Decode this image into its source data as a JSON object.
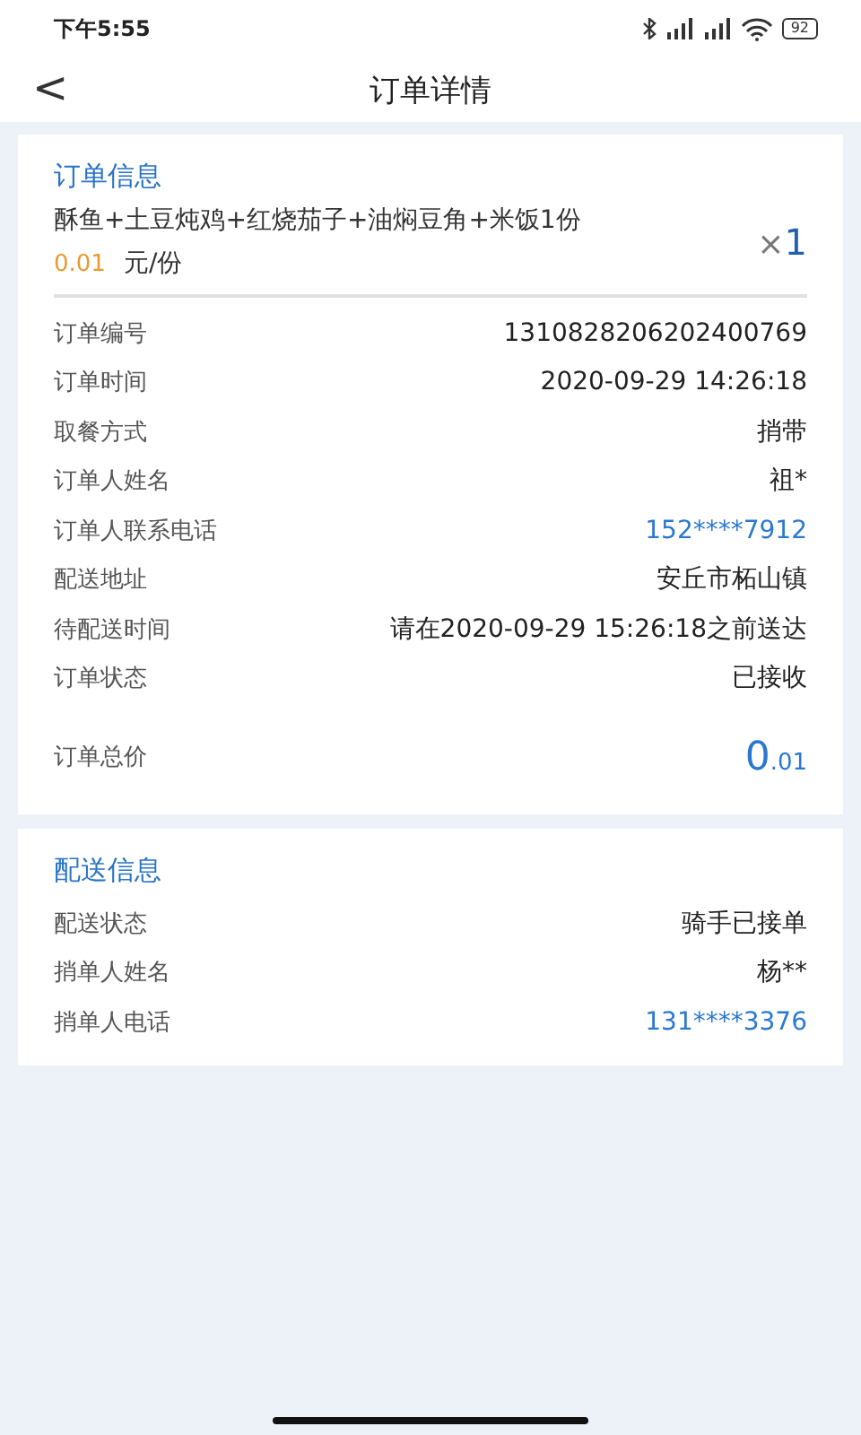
{
  "status_bar": {
    "time": "下午5:55",
    "battery": "92"
  },
  "nav": {
    "back": "<",
    "title": "订单详情"
  },
  "order_card": {
    "heading": "订单信息",
    "item": {
      "name": "酥鱼+土豆炖鸡+红烧茄子+油焖豆角+米饭1份",
      "price": "0.01",
      "unit": "元/份",
      "qty_sign": "×",
      "qty": "1"
    },
    "rows": [
      {
        "label": "订单编号",
        "value": "1310828206202400769",
        "kind": "text"
      },
      {
        "label": "订单时间",
        "value": "2020-09-29 14:26:18",
        "kind": "text"
      },
      {
        "label": "取餐方式",
        "value": "捎带",
        "kind": "text"
      },
      {
        "label": "订单人姓名",
        "value": "祖*",
        "kind": "text"
      },
      {
        "label": "订单人联系电话",
        "value": "152****7912",
        "kind": "phone"
      },
      {
        "label": "配送地址",
        "value": "安丘市柘山镇",
        "kind": "text"
      },
      {
        "label": "待配送时间",
        "value": "请在2020-09-29 15:26:18之前送达",
        "kind": "text"
      },
      {
        "label": "订单状态",
        "value": "已接收",
        "kind": "text"
      }
    ],
    "total": {
      "label": "订单总价",
      "integer": "0",
      "decimal": ".01"
    }
  },
  "delivery_card": {
    "heading": "配送信息",
    "rows": [
      {
        "label": "配送状态",
        "value": "骑手已接单",
        "kind": "text"
      },
      {
        "label": "捎单人姓名",
        "value": "杨**",
        "kind": "text"
      },
      {
        "label": "捎单人电话",
        "value": "131****3376",
        "kind": "phone"
      }
    ]
  }
}
